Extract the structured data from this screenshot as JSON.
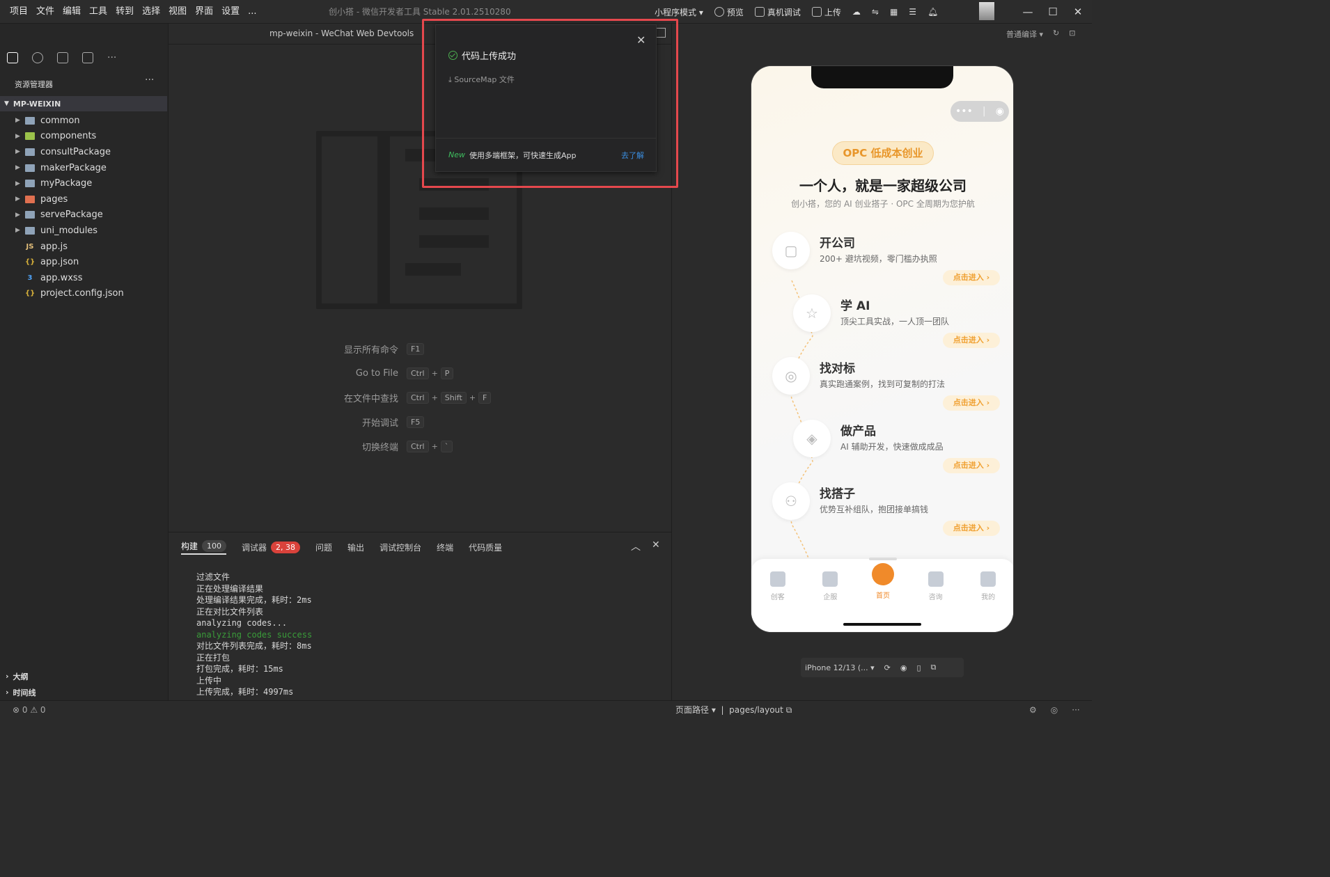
{
  "menu": [
    "项目",
    "文件",
    "编辑",
    "工具",
    "转到",
    "选择",
    "视图",
    "界面",
    "设置",
    "..."
  ],
  "app_title": "创小搭 - 微信开发者工具 Stable 2.01.2510280",
  "toolbar": {
    "mode": "小程序模式 ▾",
    "preview": "预览",
    "device_debug": "真机调试",
    "upload": "上传"
  },
  "editor_title": "mp-weixin - WeChat Web Devtools",
  "sim_compile": "普通编译 ▾",
  "explorer": {
    "title": "资源管理器",
    "more": "···",
    "project": "MP-WEIXIN",
    "items": [
      {
        "name": "common",
        "type": "folder"
      },
      {
        "name": "components",
        "type": "folder-green"
      },
      {
        "name": "consultPackage",
        "type": "folder"
      },
      {
        "name": "makerPackage",
        "type": "folder"
      },
      {
        "name": "myPackage",
        "type": "folder"
      },
      {
        "name": "pages",
        "type": "folder-red"
      },
      {
        "name": "servePackage",
        "type": "folder"
      },
      {
        "name": "uni_modules",
        "type": "folder"
      },
      {
        "name": "app.js",
        "type": "js"
      },
      {
        "name": "app.json",
        "type": "json"
      },
      {
        "name": "app.wxss",
        "type": "css"
      },
      {
        "name": "project.config.json",
        "type": "json"
      }
    ],
    "outline": "大纲",
    "timeline": "时间线"
  },
  "shortcuts": [
    {
      "label": "显示所有命令",
      "keys": [
        "F1"
      ]
    },
    {
      "label": "Go to File",
      "keys": [
        "Ctrl",
        "P"
      ]
    },
    {
      "label": "在文件中查找",
      "keys": [
        "Ctrl",
        "Shift",
        "F"
      ]
    },
    {
      "label": "开始调试",
      "keys": [
        "F5"
      ]
    },
    {
      "label": "切换终端",
      "keys": [
        "Ctrl",
        "`"
      ]
    }
  ],
  "toast": {
    "title": "代码上传成功",
    "sourcemap": "SourceMap 文件",
    "new_tag": "New",
    "footer": "使用多端框架，可快速生成App",
    "learn": "去了解"
  },
  "panel": {
    "tabs": [
      {
        "label": "构建",
        "badge": "100",
        "active": true
      },
      {
        "label": "调试器",
        "badge": "2, 38",
        "red": true
      },
      {
        "label": "问题"
      },
      {
        "label": "输出"
      },
      {
        "label": "调试控制台"
      },
      {
        "label": "终端"
      },
      {
        "label": "代码质量"
      }
    ],
    "log": [
      {
        "t": "过滤文件"
      },
      {
        "t": "正在处理编译结果"
      },
      {
        "t": "处理编译结果完成，耗时：2ms"
      },
      {
        "t": "正在对比文件列表"
      },
      {
        "t": "analyzing codes..."
      },
      {
        "t": "analyzing codes success",
        "green": true
      },
      {
        "t": "对比文件列表完成，耗时：8ms"
      },
      {
        "t": "正在打包"
      },
      {
        "t": "打包完成，耗时：15ms"
      },
      {
        "t": "上传中"
      },
      {
        "t": "上传完成，耗时：4997ms"
      }
    ]
  },
  "phone": {
    "pill": "OPC 低成本创业",
    "headline": "一个人，就是一家超级公司",
    "sub": "创小搭，您的 AI 创业搭子 · OPC 全周期为您护航",
    "items": [
      {
        "title": "开公司",
        "desc": "200+ 避坑视频，零门槛办执照",
        "go": "点击进入 ›"
      },
      {
        "title": "学 AI",
        "desc": "顶尖工具实战，一人顶一团队",
        "go": "点击进入 ›"
      },
      {
        "title": "找对标",
        "desc": "真实跑通案例，找到可复制的打法",
        "go": "点击进入 ›"
      },
      {
        "title": "做产品",
        "desc": "AI 辅助开发，快速做成成品",
        "go": "点击进入 ›"
      },
      {
        "title": "找搭子",
        "desc": "优势互补组队，抱团接单搞钱",
        "go": "点击进入 ›"
      }
    ],
    "tabs": [
      {
        "label": "创客"
      },
      {
        "label": "企服"
      },
      {
        "label": "首页",
        "active": true
      },
      {
        "label": "咨询"
      },
      {
        "label": "我的"
      }
    ]
  },
  "device": "iPhone 12/13 (... ▾",
  "status": {
    "errors": "⊗ 0 ⚠ 0",
    "path_label": "页面路径 ▾",
    "path": "pages/layout"
  }
}
